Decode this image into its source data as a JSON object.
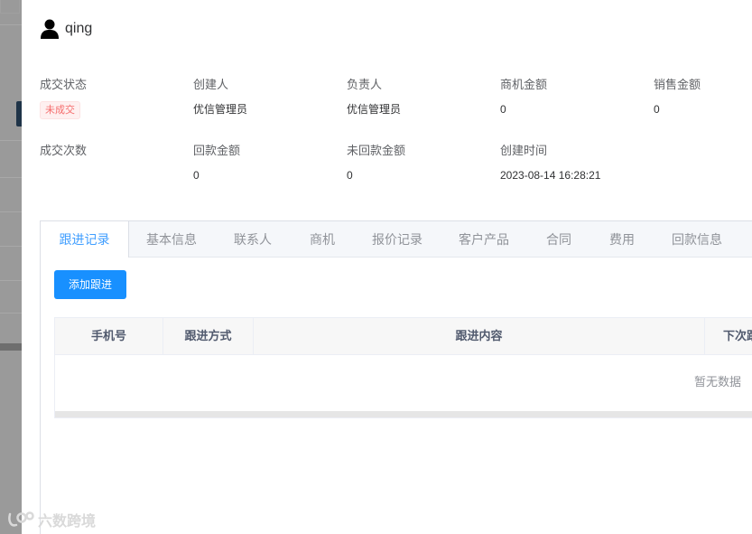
{
  "user": {
    "name": "qing",
    "icon": "user-icon"
  },
  "fields": [
    {
      "label": "成交状态",
      "tag": "未成交"
    },
    {
      "label": "创建人",
      "value": "优信管理员"
    },
    {
      "label": "负责人",
      "value": "优信管理员"
    },
    {
      "label": "商机金额",
      "value": "0"
    },
    {
      "label": "销售金额",
      "value": "0"
    },
    {
      "label": "成交次数",
      "value": ""
    },
    {
      "label": "回款金额",
      "value": "0"
    },
    {
      "label": "未回款金额",
      "value": "0"
    },
    {
      "label": "创建时间",
      "value": "2023-08-14 16:28:21"
    }
  ],
  "tabs": [
    "跟进记录",
    "基本信息",
    "联系人",
    "商机",
    "报价记录",
    "客户产品",
    "合同",
    "费用",
    "回款信息"
  ],
  "active_tab": "跟进记录",
  "add_button": "添加跟进",
  "table": {
    "columns": [
      "手机号",
      "跟进方式",
      "跟进内容",
      "下次跟"
    ],
    "empty_text": "暂无数据"
  },
  "watermark": "六数跨境",
  "colors": {
    "primary": "#1890ff",
    "tab_active": "#409eff",
    "danger": "#f56c6c"
  }
}
